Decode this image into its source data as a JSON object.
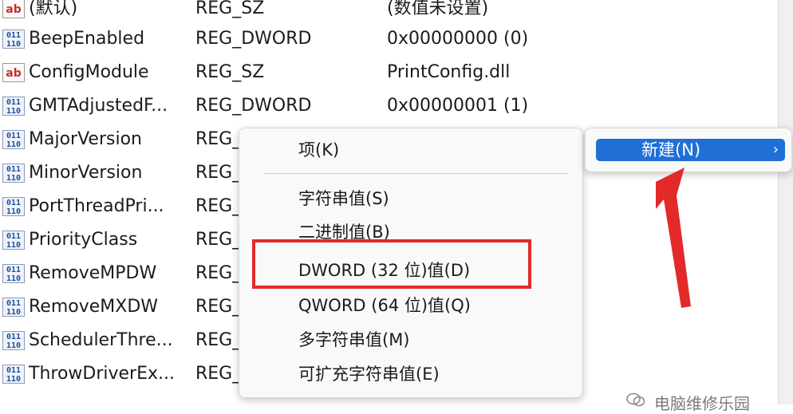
{
  "registry": {
    "rows": [
      {
        "icon": "string",
        "name": "(默认)",
        "type": "REG_SZ",
        "value": "(数值未设置)"
      },
      {
        "icon": "binary",
        "name": "BeepEnabled",
        "type": "REG_DWORD",
        "value": "0x00000000 (0)"
      },
      {
        "icon": "string",
        "name": "ConfigModule",
        "type": "REG_SZ",
        "value": "PrintConfig.dll"
      },
      {
        "icon": "binary",
        "name": "GMTAdjustedF...",
        "type": "REG_DWORD",
        "value": "0x00000001 (1)"
      },
      {
        "icon": "binary",
        "name": "MajorVersion",
        "type": "REG_",
        "value": ""
      },
      {
        "icon": "binary",
        "name": "MinorVersion",
        "type": "REG_",
        "value": ""
      },
      {
        "icon": "binary",
        "name": "PortThreadPri...",
        "type": "REG_",
        "value": ""
      },
      {
        "icon": "binary",
        "name": "PriorityClass",
        "type": "REG_",
        "value": ""
      },
      {
        "icon": "binary",
        "name": "RemoveMPDW",
        "type": "REG_",
        "value": ""
      },
      {
        "icon": "binary",
        "name": "RemoveMXDW",
        "type": "REG_",
        "value": ""
      },
      {
        "icon": "binary",
        "name": "SchedulerThre...",
        "type": "REG_",
        "value": ""
      },
      {
        "icon": "binary",
        "name": "ThrowDriverEx...",
        "type": "REG_",
        "value": ""
      }
    ]
  },
  "icons": {
    "string_glyph": "ab",
    "binary_glyph": "011\n110"
  },
  "context_menu": {
    "items": [
      {
        "label": "项(K)"
      },
      {
        "label": "字符串值(S)"
      },
      {
        "label": "二进制值(B)"
      },
      {
        "label": "DWORD (32 位)值(D)",
        "highlighted": true
      },
      {
        "label": "QWORD (64 位)值(Q)"
      },
      {
        "label": "多字符串值(M)"
      },
      {
        "label": "可扩充字符串值(E)"
      }
    ]
  },
  "submenu_parent": {
    "label": "新建(N)",
    "chevron": "›"
  },
  "watermark": {
    "text": "电脑维修乐园"
  },
  "colors": {
    "selection_blue": "#1f6fd6",
    "annotation_red": "#e32a2a"
  }
}
